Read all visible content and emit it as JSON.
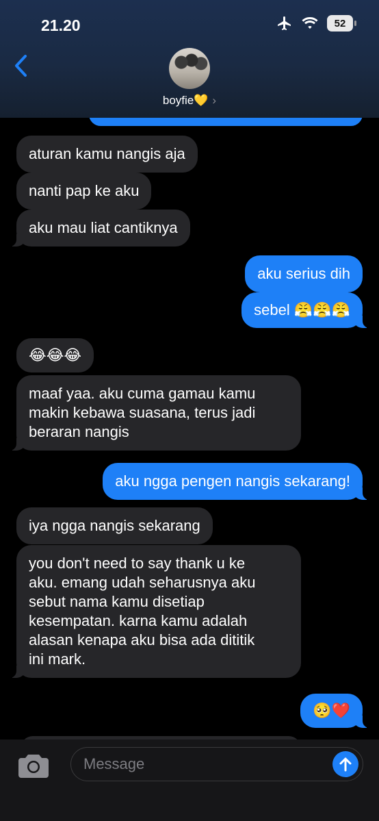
{
  "status_bar": {
    "time": "21.20",
    "battery": "52"
  },
  "header": {
    "contact_name": "boyfie💛",
    "chevron": "›",
    "back_icon": "chevron-left-icon"
  },
  "messages": [
    {
      "direction": "in",
      "text": "aturan kamu nangis aja"
    },
    {
      "direction": "in",
      "text": "nanti pap ke aku"
    },
    {
      "direction": "in",
      "text": "aku mau liat cantiknya"
    },
    {
      "direction": "out",
      "text": "aku serius dih"
    },
    {
      "direction": "out",
      "text": "sebel 😤😤😤"
    },
    {
      "direction": "in",
      "text": "😂😂😂"
    },
    {
      "direction": "in",
      "text": "maaf yaa. aku cuma gamau kamu\nmakin kebawa suasana, terus jadi\nberaran nangis"
    },
    {
      "direction": "out",
      "text": "aku ngga pengen nangis sekarang!"
    },
    {
      "direction": "in",
      "text": "iya ngga nangis sekarang"
    },
    {
      "direction": "in",
      "text": "you don't need to say thank u ke\naku. emang udah seharusnya aku\nsebut nama kamu disetiap\nkesempatan. karna kamu adalah\nalasan kenapa aku bisa ada dititik\nini mark."
    },
    {
      "direction": "out",
      "text": "🥺❤️"
    }
  ],
  "composer": {
    "placeholder": "Message"
  },
  "colors": {
    "outgoing": "#1e80f7",
    "incoming": "#262629",
    "background": "#000000"
  }
}
